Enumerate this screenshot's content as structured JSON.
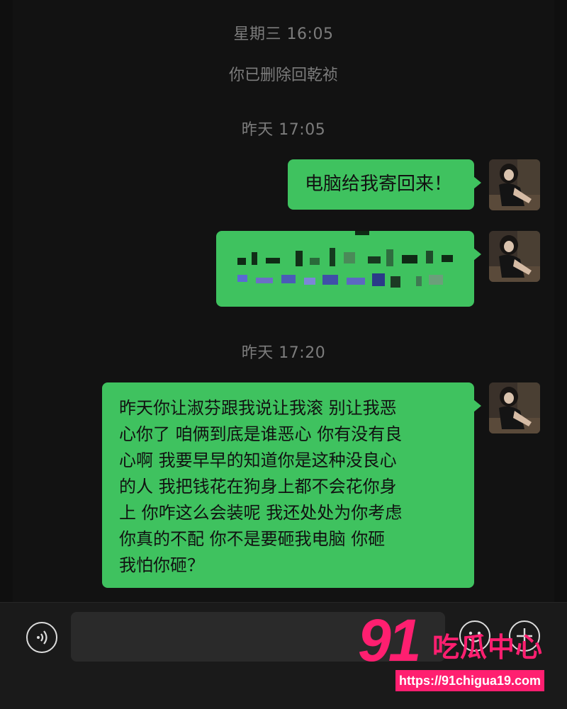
{
  "chat": {
    "timestamps": [
      "星期三 16:05",
      "昨天 17:05",
      "昨天 17:20"
    ],
    "system_notice": "你已删除回乾祯",
    "messages": [
      {
        "text": "电脑给我寄回来！",
        "from": "me"
      },
      {
        "text": "",
        "from": "me",
        "redacted": true
      },
      {
        "text": "昨天你让淑芬跟我说让我滚 别让我恶\n心你了 咱俩到底是谁恶心 你有没有良\n心啊 我要早早的知道你是这种没良心\n的人 我把钱花在狗身上都不会花你身\n上 你咋这么会装呢 我还处处为你考虑\n你真的不配 你不是要砸我电脑 你砸\n我怕你砸？",
        "from": "me"
      }
    ]
  },
  "input_bar": {
    "voice_icon": "voice-icon",
    "emoji_icon": "emoji-icon",
    "plus_icon": "plus-icon",
    "input_value": ""
  },
  "watermark": {
    "number": "91",
    "text": "吃瓜中心",
    "url": "https://91chigua19.com"
  },
  "colors": {
    "bubble": "#3fc25f",
    "background": "#121212",
    "watermark": "#ff1f70"
  }
}
